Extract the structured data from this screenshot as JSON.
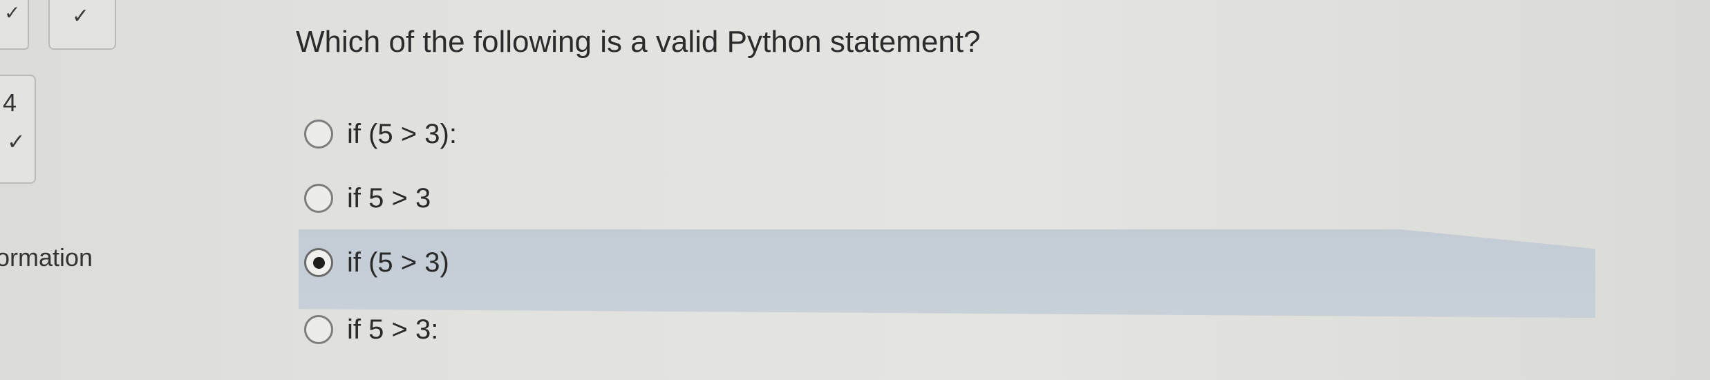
{
  "sidebar": {
    "number": "4",
    "partial_label": "ormation",
    "check_glyph": "✓"
  },
  "question": {
    "text": "Which of the following is a valid Python statement?"
  },
  "options": [
    {
      "label": "if (5 > 3):",
      "selected": false
    },
    {
      "label": "if 5 > 3",
      "selected": false
    },
    {
      "label": "if (5 > 3)",
      "selected": true
    },
    {
      "label": "if 5 > 3:",
      "selected": false
    }
  ],
  "colors": {
    "selected_highlight": "#c5cdd6",
    "radio_border": "#7d7d7d",
    "background": "#e2e2df"
  }
}
